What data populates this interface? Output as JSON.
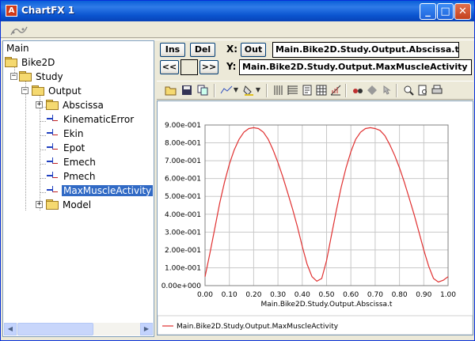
{
  "window": {
    "title": "ChartFX 1",
    "title_icon": "A",
    "minimize_glyph": "_",
    "maximize_glyph": "□",
    "close_glyph": "✕"
  },
  "tree": {
    "items": [
      {
        "label": "Main",
        "icon": "none",
        "expander": "",
        "selected": false
      },
      {
        "label": "Bike2D",
        "icon": "folder-icon",
        "expander": "",
        "selected": false
      },
      {
        "label": "Study",
        "icon": "folder-icon",
        "expander": "−",
        "selected": false
      },
      {
        "label": "Output",
        "icon": "folder-icon",
        "expander": "−",
        "selected": false
      },
      {
        "label": "Abscissa",
        "icon": "folder-icon",
        "expander": "+",
        "selected": false
      },
      {
        "label": "KinematicError",
        "icon": "variable-icon",
        "expander": "",
        "selected": false
      },
      {
        "label": "Ekin",
        "icon": "variable-icon",
        "expander": "",
        "selected": false
      },
      {
        "label": "Epot",
        "icon": "variable-icon",
        "expander": "",
        "selected": false
      },
      {
        "label": "Emech",
        "icon": "variable-icon",
        "expander": "",
        "selected": false
      },
      {
        "label": "Pmech",
        "icon": "variable-icon",
        "expander": "",
        "selected": false
      },
      {
        "label": "MaxMuscleActivity",
        "icon": "variable-icon",
        "expander": "",
        "selected": true
      },
      {
        "label": "Model",
        "icon": "folder-icon",
        "expander": "+",
        "selected": false
      }
    ],
    "scroll_left_glyph": "◀",
    "scroll_right_glyph": "▶"
  },
  "controls": {
    "ins_label": "Ins",
    "del_label": "Del",
    "x_label": "X:",
    "out_label": "Out",
    "x_value": "Main.Bike2D.Study.Output.Abscissa.t",
    "prev_label": "<<",
    "next_label": ">>",
    "y_label": "Y:",
    "y_value": "Main.Bike2D.Study.Output.MaxMuscleActivity"
  },
  "chart_toolbar": {
    "icons": [
      "open-icon",
      "save-icon",
      "copy-icon",
      "gallery-icon",
      "color-icon",
      "vertical-grid-icon",
      "horizontal-grid-icon",
      "properties-icon",
      "data-grid-icon",
      "legend-icon",
      "3d-icon",
      "rotate-icon",
      "pointer-icon",
      "zoom-icon",
      "print-preview-icon",
      "print-icon"
    ]
  },
  "chart_data": {
    "type": "line",
    "xlabel": "Main.Bike2D.Study.Output.Abscissa.t",
    "ylabel": "",
    "xlim": [
      0,
      1
    ],
    "ylim": [
      0,
      0.9
    ],
    "x_ticks": [
      "0.00",
      "0.10",
      "0.20",
      "0.30",
      "0.40",
      "0.50",
      "0.60",
      "0.70",
      "0.80",
      "0.90",
      "1.00"
    ],
    "y_ticks": [
      "0.00e+000",
      "1.00e-001",
      "2.00e-001",
      "3.00e-001",
      "4.00e-001",
      "5.00e-001",
      "6.00e-001",
      "7.00e-001",
      "8.00e-001",
      "9.00e-001"
    ],
    "grid": true,
    "legend_position": "bottom-left",
    "series": [
      {
        "name": "Main.Bike2D.Study.Output.MaxMuscleActivity",
        "color": "#e03030",
        "x": [
          0.0,
          0.02,
          0.04,
          0.06,
          0.08,
          0.1,
          0.12,
          0.14,
          0.16,
          0.18,
          0.2,
          0.22,
          0.24,
          0.26,
          0.28,
          0.3,
          0.32,
          0.34,
          0.36,
          0.38,
          0.4,
          0.42,
          0.44,
          0.46,
          0.48,
          0.5,
          0.52,
          0.54,
          0.56,
          0.58,
          0.6,
          0.62,
          0.64,
          0.66,
          0.68,
          0.7,
          0.72,
          0.74,
          0.76,
          0.78,
          0.8,
          0.82,
          0.84,
          0.86,
          0.88,
          0.9,
          0.92,
          0.94,
          0.96,
          0.98,
          1.0
        ],
        "values": [
          0.05,
          0.18,
          0.32,
          0.46,
          0.58,
          0.68,
          0.76,
          0.82,
          0.86,
          0.88,
          0.885,
          0.88,
          0.86,
          0.82,
          0.76,
          0.69,
          0.61,
          0.52,
          0.43,
          0.33,
          0.22,
          0.12,
          0.05,
          0.025,
          0.04,
          0.14,
          0.28,
          0.42,
          0.55,
          0.66,
          0.75,
          0.82,
          0.86,
          0.88,
          0.885,
          0.88,
          0.87,
          0.84,
          0.79,
          0.73,
          0.66,
          0.58,
          0.49,
          0.4,
          0.3,
          0.2,
          0.11,
          0.04,
          0.02,
          0.03,
          0.05
        ]
      }
    ]
  }
}
